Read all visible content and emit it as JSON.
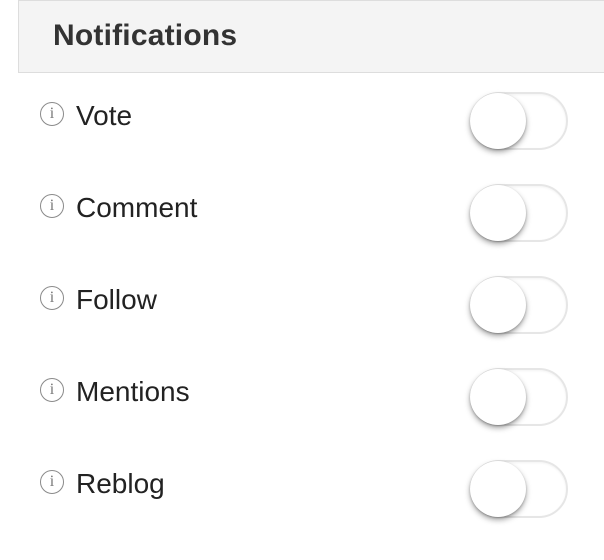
{
  "header": {
    "title": "Notifications"
  },
  "icons": {
    "info": "i"
  },
  "settings": [
    {
      "label": "Vote",
      "enabled": false
    },
    {
      "label": "Comment",
      "enabled": false
    },
    {
      "label": "Follow",
      "enabled": false
    },
    {
      "label": "Mentions",
      "enabled": false
    },
    {
      "label": "Reblog",
      "enabled": false
    }
  ]
}
